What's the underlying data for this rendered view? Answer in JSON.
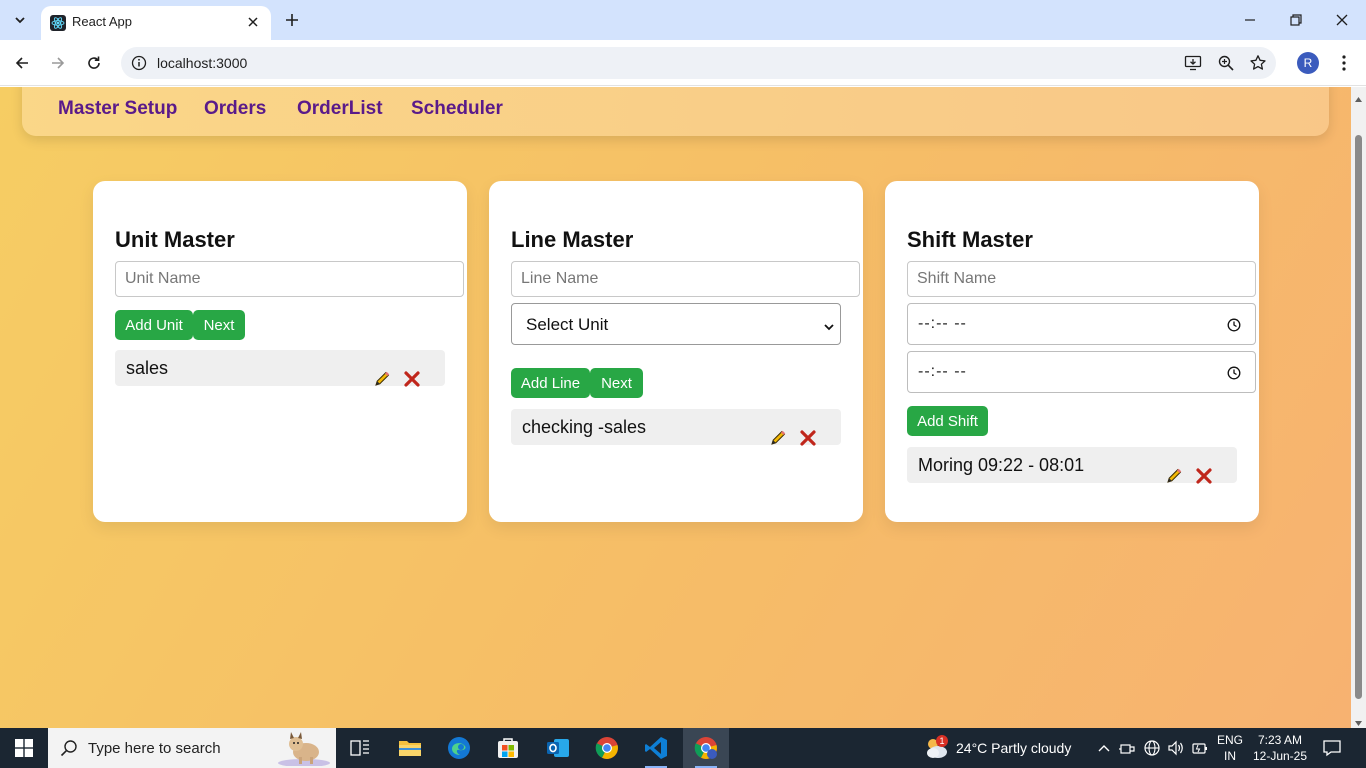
{
  "browser": {
    "tab_title": "React App",
    "url": "localhost:3000"
  },
  "profile_initial": "R",
  "nav": [
    "Master Setup",
    "Orders",
    "OrderList",
    "Scheduler"
  ],
  "unit_master": {
    "title": "Unit Master",
    "unit_name_placeholder": "Unit Name",
    "add_label": "Add Unit",
    "next_label": "Next",
    "items": [
      "sales"
    ]
  },
  "line_master": {
    "title": "Line Master",
    "line_name_placeholder": "Line Name",
    "select_unit": "Select Unit",
    "add_label": "Add Line",
    "next_label": "Next",
    "items": [
      "checking -sales"
    ]
  },
  "shift_master": {
    "title": "Shift Master",
    "shift_name_placeholder": "Shift Name",
    "start_time": "--:-- --",
    "end_time": "--:-- --",
    "add_label": "Add Shift",
    "items": [
      "Moring 09:22 - 08:01"
    ]
  },
  "taskbar": {
    "search_placeholder": "Type here to search",
    "weather_badge": "1",
    "weather": "24°C  Partly cloudy",
    "lang_1": "ENG",
    "lang_2": "IN",
    "time": "7:23 AM",
    "date": "12-Jun-25"
  },
  "colors": {
    "nav_link": "#5a1a8a",
    "button": "#28a745",
    "delete": "#c0261b"
  }
}
